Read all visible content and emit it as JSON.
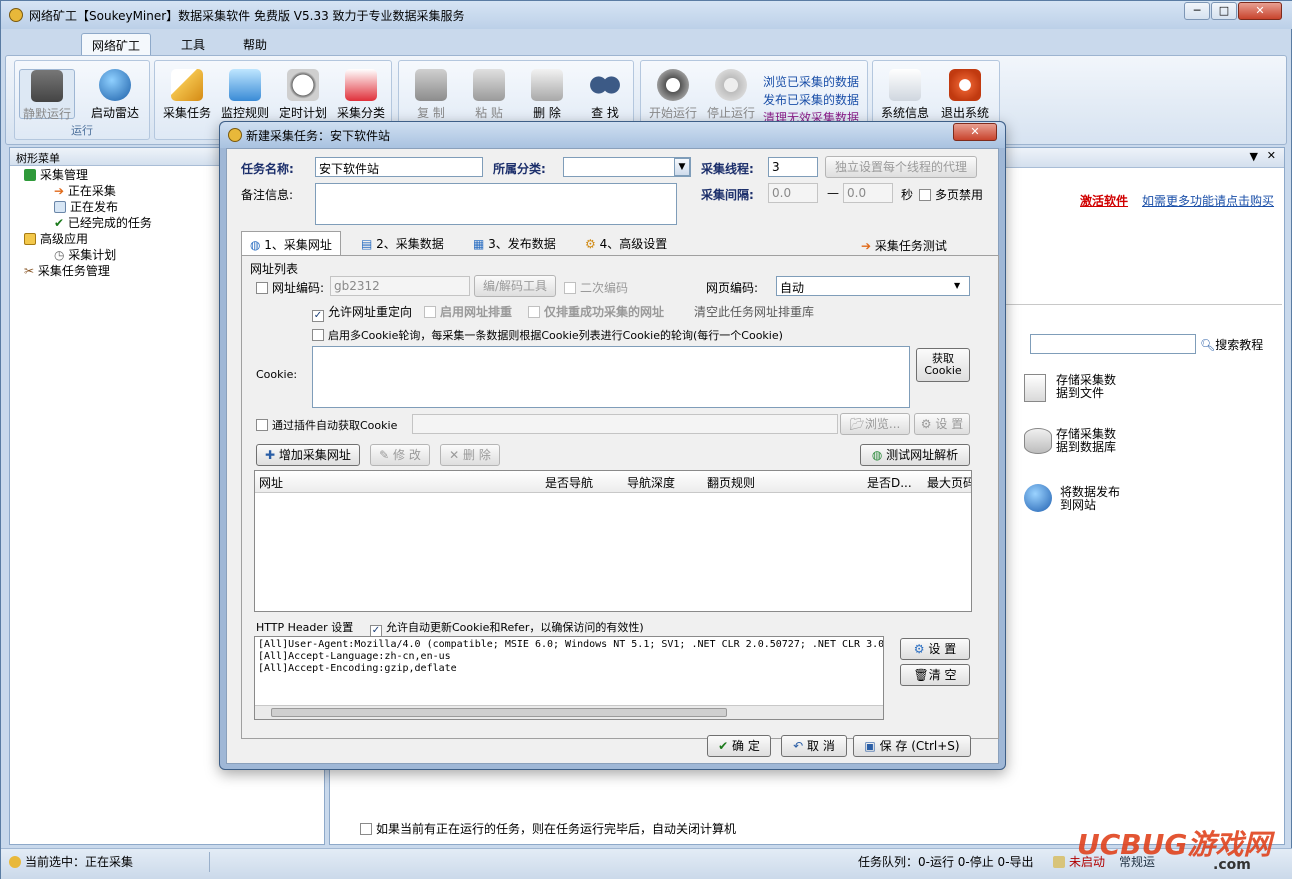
{
  "window": {
    "title": "网络矿工【SoukeyMiner】数据采集软件 免费版 V5.33 致力于专业数据采集服务",
    "controls": {
      "minimize": "─",
      "maximize": "□",
      "close": "✕"
    }
  },
  "menu": {
    "items": [
      "网络矿工",
      "工具",
      "帮助"
    ]
  },
  "ribbon": {
    "run_group": {
      "silent_run": "静默运行",
      "start_radar": "启动雷达",
      "label": "运行"
    },
    "task_buttons": [
      "采集任务",
      "监控规则",
      "定时计划",
      "采集分类"
    ],
    "edit_buttons": [
      "复 制",
      "粘 贴",
      "删 除",
      "查 找"
    ],
    "run_buttons": [
      "开始运行",
      "停止运行"
    ],
    "data_links": [
      "浏览已采集的数据",
      "发布已采集的数据",
      "清理无效采集数据"
    ],
    "system_buttons": [
      "系统信息",
      "退出系统"
    ]
  },
  "tree": {
    "header": "树形菜单",
    "items": [
      {
        "label": "采集管理",
        "level": 0
      },
      {
        "label": "正在采集",
        "level": 1
      },
      {
        "label": "正在发布",
        "level": 1
      },
      {
        "label": "已经完成的任务",
        "level": 1
      },
      {
        "label": "高级应用",
        "level": 0
      },
      {
        "label": "采集计划",
        "level": 1
      },
      {
        "label": "采集任务管理",
        "level": 0
      }
    ]
  },
  "right_panel": {
    "activate_link": "激活软件",
    "buy_link": "如需更多功能请点击购买",
    "search_button": "搜索教程",
    "search_value": "",
    "shortcuts": [
      "存储采集数据到文件",
      "存储采集数据到数据库",
      "将数据发布到网站"
    ],
    "shutdown_option": "如果当前有正在运行的任务，则在任务运行完毕后，自动关闭计算机"
  },
  "status": {
    "current": "当前选中：正在采集",
    "queue": "任务队列：0-运行 0-停止 0-导出",
    "radar": "未启动",
    "monitor": "常规运"
  },
  "dialog": {
    "title": "新建采集任务：安下软件站",
    "task_name_label": "任务名称:",
    "task_name": "安下软件站",
    "category_label": "所属分类:",
    "category_value": "",
    "threads_label": "采集线程:",
    "threads_value": "3",
    "thread_proxy_button": "独立设置每个线程的代理",
    "notes_label": "备注信息:",
    "notes_value": "",
    "interval_label": "采集间隔:",
    "interval_from": "0.0",
    "interval_dash": "—",
    "interval_to": "0.0",
    "interval_unit": "秒",
    "multi_page_disable": "多页禁用",
    "tabs": [
      "1、采集网址",
      "2、采集数据",
      "3、发布数据",
      "4、高级设置"
    ],
    "test_task": "采集任务测试",
    "url_list_group": "网址列表",
    "url_encoding_label": "网址编码:",
    "url_encoding_value": "gb2312",
    "encode_tool_button": "编/解码工具",
    "double_encoding": "二次编码",
    "page_encoding_label": "网页编码:",
    "page_encoding_value": "自动",
    "allow_redirect": "允许网址重定向",
    "enable_dedup": "启用网址排重",
    "dedup_success_only": "仅排重成功采集的网址",
    "clear_dedup": "清空此任务网址排重库",
    "multi_cookie": "启用多Cookie轮询，每采集一条数据则根据Cookie列表进行Cookie的轮询(每行一个Cookie)",
    "cookie_label": "Cookie:",
    "cookie_value": "",
    "get_cookie_button": [
      "获取",
      "Cookie"
    ],
    "plugin_cookie": "通过插件自动获取Cookie",
    "browse_button": "浏览...",
    "settings_button": "设 置",
    "add_url_button": "增加采集网址",
    "edit_button": "修 改",
    "delete_button": "删 除",
    "test_parse_button": "测试网址解析",
    "url_columns": [
      "网址",
      "是否导航",
      "导航深度",
      "翻页规则",
      "是否D...",
      "最大页码"
    ],
    "http_header_label": "HTTP Header 设置",
    "auto_update_cookie": "允许自动更新Cookie和Refer，以确保访问的有效性)",
    "headers": [
      "[All]User-Agent:Mozilla/4.0 (compatible; MSIE 6.0; Windows NT 5.1; SV1; .NET CLR 2.0.50727; .NET CLR 3.0",
      "[All]Accept-Language:zh-cn,en-us",
      "[All]Accept-Encoding:gzip,deflate"
    ],
    "header_set_button": "设 置",
    "header_clear_button": "清 空",
    "ok_button": "确 定",
    "cancel_button": "取 消",
    "save_button": "保 存 (Ctrl+S)"
  },
  "watermark": {
    "brand": "UCBUG游戏网",
    "domain": ".com"
  }
}
